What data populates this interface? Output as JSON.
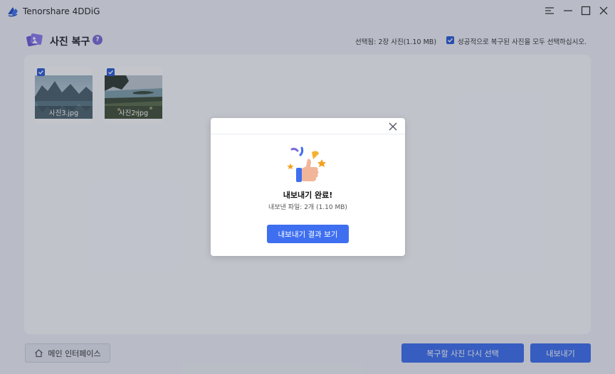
{
  "app": {
    "title": "Tenorshare 4DDiG"
  },
  "header": {
    "section_title": "사진 복구",
    "help": "?",
    "selected_info": "선택됨: 2장 사진(1.10 MB)",
    "select_all_label": "성공적으로 복구된 사진을 모두 선택하십시오.",
    "select_all_checked": true
  },
  "thumbnails": [
    {
      "name": "사진3.jpg",
      "checked": true
    },
    {
      "name": "사진2.jpg",
      "checked": true
    }
  ],
  "footer": {
    "main_button": "메인 인터페이스",
    "reselect_button": "복구할 사진 다시 선택",
    "export_button": "내보내기"
  },
  "dialog": {
    "title": "내보내기 완료!",
    "subtitle": "내보낸 파일: 2개 (1.10 MB)",
    "button": "내보내기 결과 보기"
  },
  "colors": {
    "accent": "#3e6ff0",
    "checkbox": "#2a5bd7"
  }
}
